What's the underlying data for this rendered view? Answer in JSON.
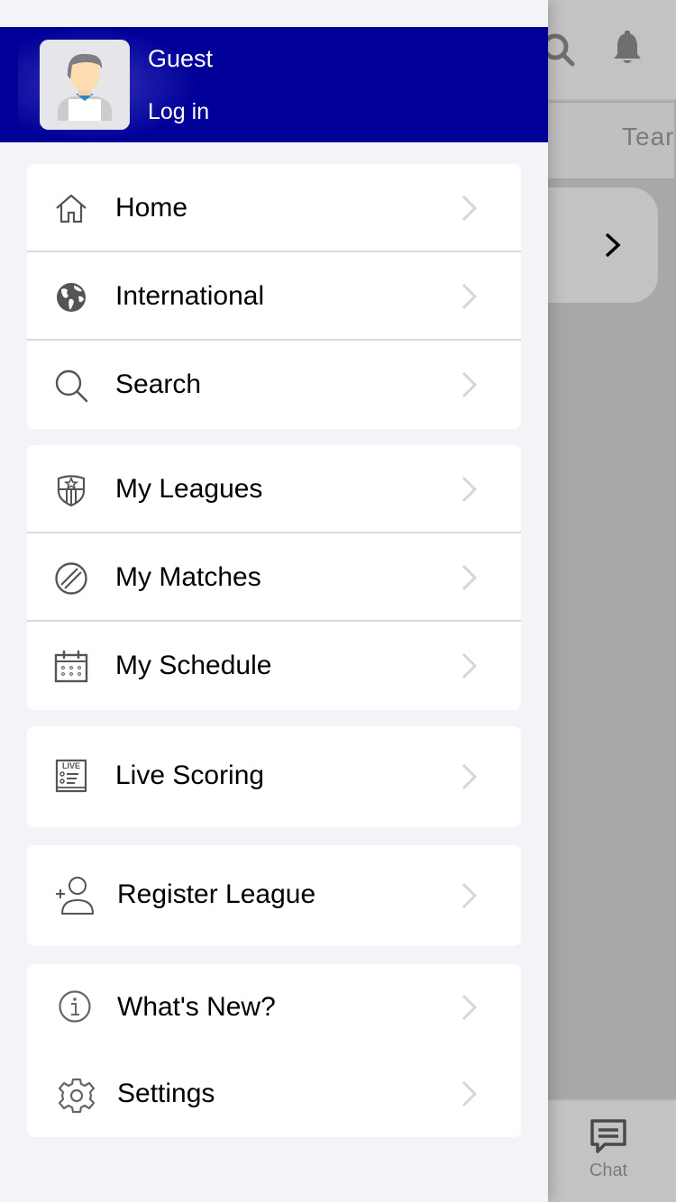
{
  "background_app": {
    "header_icons": [
      "search-icon",
      "bell-icon"
    ],
    "tab_partial_label": "Tear",
    "bottom_nav": {
      "chat_label": "Chat",
      "chat_icon": "chat-bubble-icon"
    }
  },
  "drawer": {
    "profile": {
      "name": "Guest",
      "login_label": "Log in",
      "avatar_icon": "user-avatar-icon",
      "header_color": "#000099"
    },
    "groups": [
      {
        "items": [
          {
            "label": "Home",
            "icon": "home-icon"
          },
          {
            "label": "International",
            "icon": "globe-icon"
          },
          {
            "label": "Search",
            "icon": "search-icon"
          }
        ]
      },
      {
        "items": [
          {
            "label": "My Leagues",
            "icon": "shield-star-icon"
          },
          {
            "label": "My Matches",
            "icon": "cricket-ball-icon"
          },
          {
            "label": "My Schedule",
            "icon": "calendar-icon"
          }
        ]
      },
      {
        "items": [
          {
            "label": "Live Scoring",
            "icon": "live-scoreboard-icon",
            "icon_text": "LIVE"
          }
        ]
      },
      {
        "items": [
          {
            "label": "Register League",
            "icon": "add-user-icon"
          }
        ]
      },
      {
        "items": [
          {
            "label": "What's New?",
            "icon": "info-icon"
          },
          {
            "label": "Settings",
            "icon": "gear-icon"
          }
        ]
      }
    ]
  }
}
